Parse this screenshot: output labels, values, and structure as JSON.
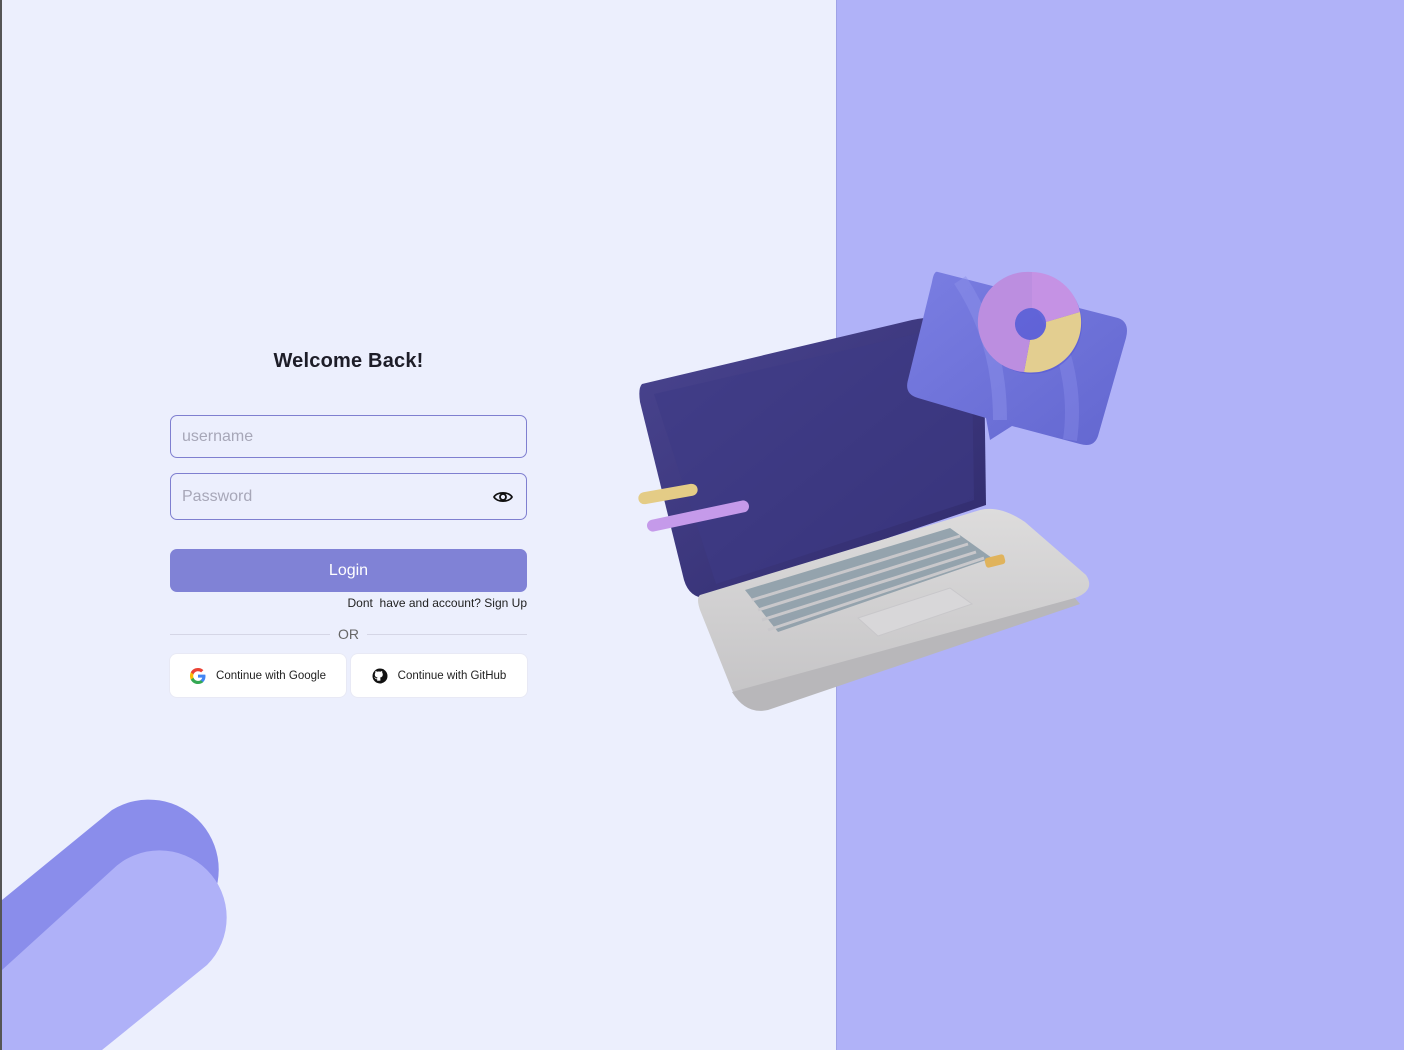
{
  "login": {
    "title": "Welcome Back!",
    "username_placeholder": "username",
    "password_placeholder": "Password",
    "login_label": "Login",
    "signup_prompt": "Dont  have and account?",
    "signup_link": "Sign Up",
    "or_label": "OR",
    "google_label": "Continue with Google",
    "github_label": "Continue with GitHub"
  },
  "icons": {
    "password_toggle": "eye-icon",
    "google": "google-icon",
    "github": "github-icon"
  },
  "colors": {
    "left_background": "#ECEFFD",
    "right_background": "#B0B2F8",
    "accent": "#8082D6",
    "input_border": "#7F7FD0"
  }
}
